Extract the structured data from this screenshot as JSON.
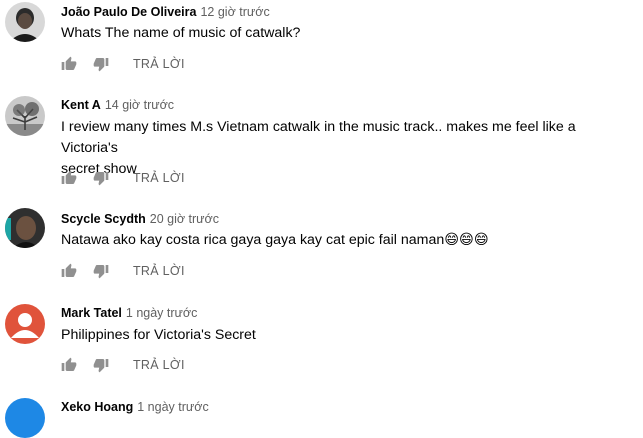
{
  "comments": [
    {
      "author": "João Paulo De Oliveira",
      "time": "12 giờ trước",
      "text_lines": [
        "Whats The name of music of catwalk?"
      ],
      "avatar_icon": "portrait-photo",
      "reply_label": "TRẢ LỜI"
    },
    {
      "author": "Kent A",
      "time": "14 giờ trước",
      "text_lines": [
        "I review many times M.s Vietnam catwalk in the music track.. makes me feel like a Victoria's",
        "secret show"
      ],
      "avatar_icon": "tree-photo",
      "reply_label": "TRẢ LỜI"
    },
    {
      "author": "Scycle Scydth",
      "time": "20 giờ trước",
      "text_lines": [
        "Natawa ako kay costa rica gaya gaya kay cat epic fail naman😄😄😄"
      ],
      "avatar_icon": "dark-photo",
      "reply_label": "TRẢ LỜI"
    },
    {
      "author": "Mark Tatel",
      "time": "1 ngày trước",
      "text_lines": [
        "Philippines for Victoria's Secret"
      ],
      "avatar_icon": "default-person-icon",
      "avatar_color": "#e0533b",
      "reply_label": "TRẢ LỜI"
    },
    {
      "author": "Xeko Hoang",
      "time": "1 ngày trước",
      "avatar_icon": "default-avatar",
      "avatar_color": "#1e88e5"
    }
  ],
  "icons": {
    "like": "thumb-up-icon",
    "dislike": "thumb-down-icon"
  },
  "colors": {
    "meta": "#606060",
    "text": "#030303"
  }
}
